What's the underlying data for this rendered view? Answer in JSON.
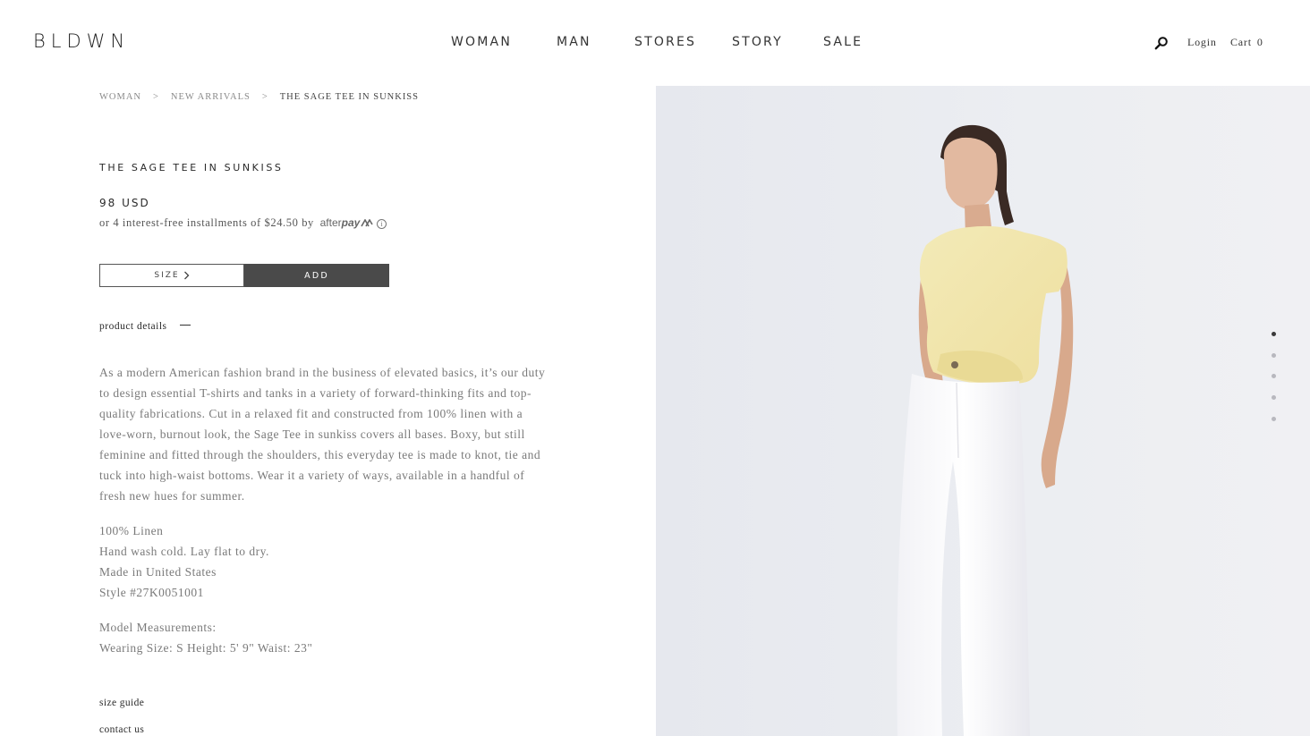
{
  "header": {
    "logo": "BLDWN",
    "nav": [
      "WOMAN",
      "MAN",
      "STORES",
      "STORY",
      "SALE"
    ],
    "login_label": "Login",
    "cart_label": "Cart",
    "cart_count": "0",
    "search_icon": "search-icon"
  },
  "breadcrumb": {
    "items": [
      "WOMAN",
      "NEW ARRIVALS",
      "THE SAGE TEE IN SUNKISS"
    ],
    "separator": ">"
  },
  "product": {
    "title": "THE SAGE TEE IN SUNKISS",
    "price": "98 USD",
    "installments_text": "or 4 interest-free installments of $24.50 by",
    "afterpay_brand_light": "after",
    "afterpay_brand_bold": "pay",
    "afterpay_logo_icon": "afterpay-arrows-icon",
    "info_icon": "info-icon",
    "size_label": "SIZE",
    "add_label": "ADD",
    "details_label": "product details",
    "description": "As a modern American fashion brand in the business of elevated basics, it’s our duty to design essential T-shirts and tanks in a variety of forward-thinking fits and top-quality fabrications. Cut in a relaxed fit and constructed from 100% linen with a love-worn, burnout look, the Sage Tee in sunkiss covers all bases. Boxy, but still feminine and fitted through the shoulders, this everyday tee is made to knot, tie and tuck into high-waist bottoms. Wear it a variety of ways, available in a handful of fresh new hues for summer.",
    "specs": [
      "100% Linen",
      "Hand wash cold. Lay flat to dry.",
      "Made in United States",
      "Style #27K0051001"
    ],
    "model": [
      "Model Measurements:",
      "Wearing Size: S Height: 5' 9\" Waist: 23\""
    ],
    "size_guide_label": "size guide",
    "contact_label": "contact us"
  },
  "gallery": {
    "image_count": 5,
    "active_index": 0
  },
  "colors": {
    "add_button_bg": "#4a4a4a",
    "image_bg": "#e9eaef",
    "tee": "#f2e7ad",
    "pants": "#ffffff"
  }
}
